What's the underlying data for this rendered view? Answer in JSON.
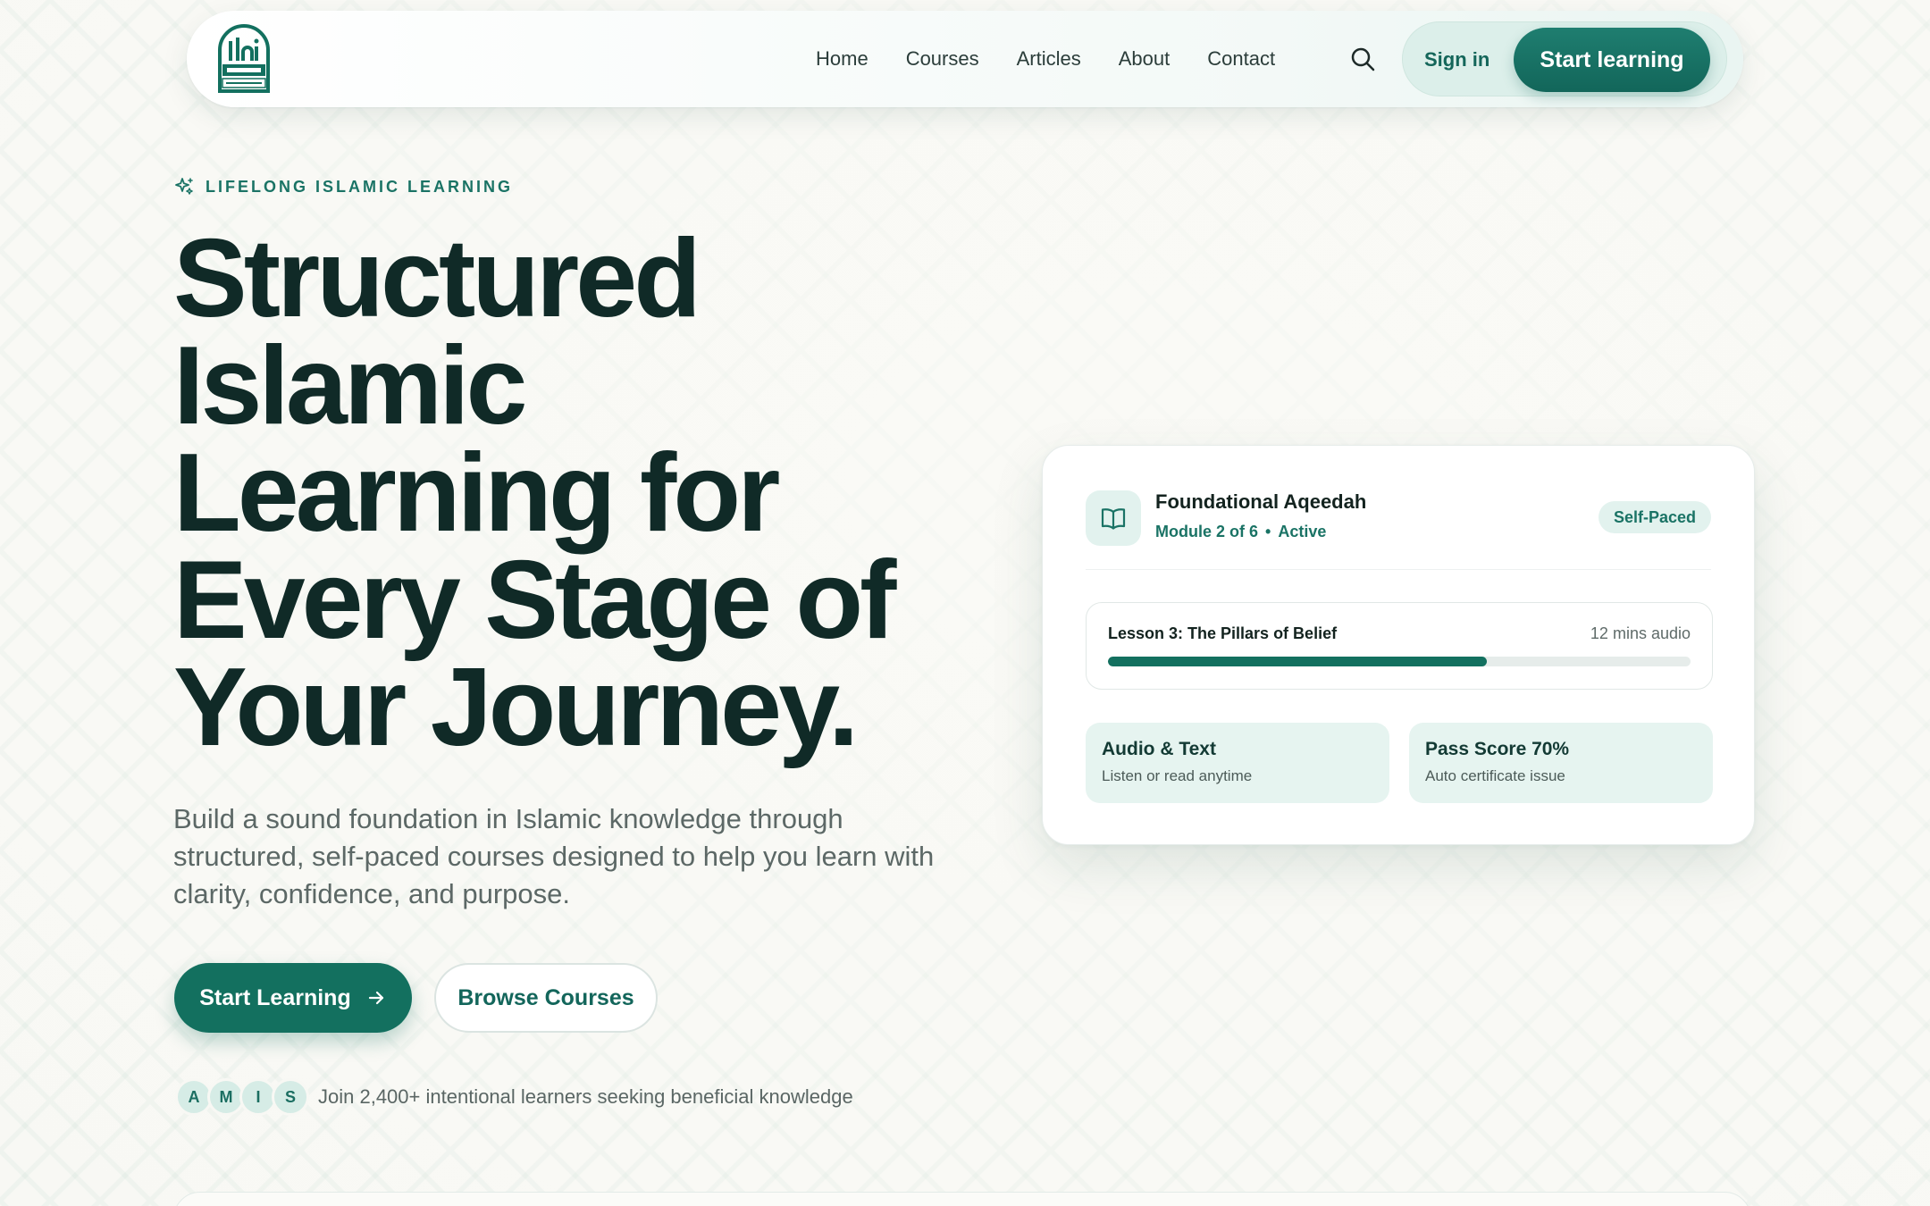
{
  "nav": {
    "logo_name": "ilm-forge-logo",
    "links": [
      "Home",
      "Courses",
      "Articles",
      "About",
      "Contact"
    ],
    "signin": "Sign in",
    "cta": "Start learning"
  },
  "hero": {
    "eyebrow": "LIFELONG ISLAMIC LEARNING",
    "headline": [
      "Structured",
      "Islamic",
      "Learning for",
      "Every Stage of",
      "Your Journey."
    ],
    "lede": "Build a sound foundation in Islamic knowledge through structured, self-paced courses designed to help you learn with clarity, confidence, and purpose.",
    "primary_button": "Start Learning",
    "secondary_button": "Browse Courses",
    "avatars": [
      "A",
      "M",
      "I",
      "S"
    ],
    "social_proof": "Join 2,400+ intentional learners seeking beneficial knowledge"
  },
  "card": {
    "title": "Foundational Aqeedah",
    "module": "Module 2 of 6",
    "status": "Active",
    "badge": "Self-Paced",
    "lesson": {
      "name": "Lesson 3: The Pillars of Belief",
      "length": "12 mins audio",
      "progress_percent": 65
    },
    "stats": [
      {
        "title": "Audio & Text",
        "desc": "Listen or read anytime"
      },
      {
        "title": "Pass Score 70%",
        "desc": "Auto certificate issue"
      }
    ]
  },
  "colors": {
    "brand": "#13705f",
    "brand_light": "#e2f2ee",
    "text_dark": "#102a27",
    "background": "#f8f8f4"
  }
}
